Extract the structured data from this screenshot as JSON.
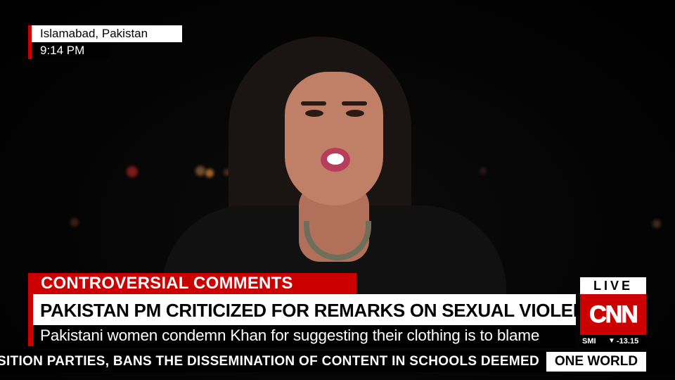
{
  "location": {
    "city": "Islamabad, Pakistan",
    "time": "9:14 PM"
  },
  "chyron": {
    "kicker": "CONTROVERSIAL COMMENTS",
    "headline": "PAKISTAN PM CRITICIZED FOR REMARKS ON SEXUAL VIOLENCE",
    "subline": "Pakistani women condemn Khan for suggesting their clothing is to blame"
  },
  "network": {
    "live_label": "LIVE",
    "logo_text": "CNN",
    "market_name": "SMI",
    "market_value": "-13.15"
  },
  "ticker": {
    "text": "SITION PARTIES, BANS THE DISSEMINATION OF CONTENT IN SCHOOLS DEEMED",
    "program": "ONE WORLD"
  },
  "colors": {
    "brand_red": "#cc0000",
    "white": "#ffffff",
    "black": "#000000"
  },
  "icons": {
    "market_down": "down-triangle-icon"
  }
}
